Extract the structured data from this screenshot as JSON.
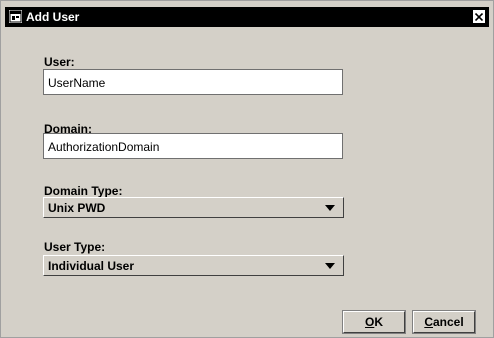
{
  "window": {
    "title": "Add User"
  },
  "form": {
    "user": {
      "label": "User:",
      "value": "UserName"
    },
    "domain": {
      "label": "Domain:",
      "value": "AuthorizationDomain"
    },
    "domain_type": {
      "label": "Domain Type:",
      "selected": "Unix PWD"
    },
    "user_type": {
      "label": "User Type:",
      "selected": "Individual User"
    }
  },
  "buttons": {
    "ok": {
      "mnemonic": "O",
      "rest": "K"
    },
    "cancel": {
      "mnemonic": "C",
      "rest": "ancel"
    }
  },
  "icons": {
    "app": "app-window-icon",
    "close": "close-icon",
    "dropdown": "triangle-down-icon"
  }
}
